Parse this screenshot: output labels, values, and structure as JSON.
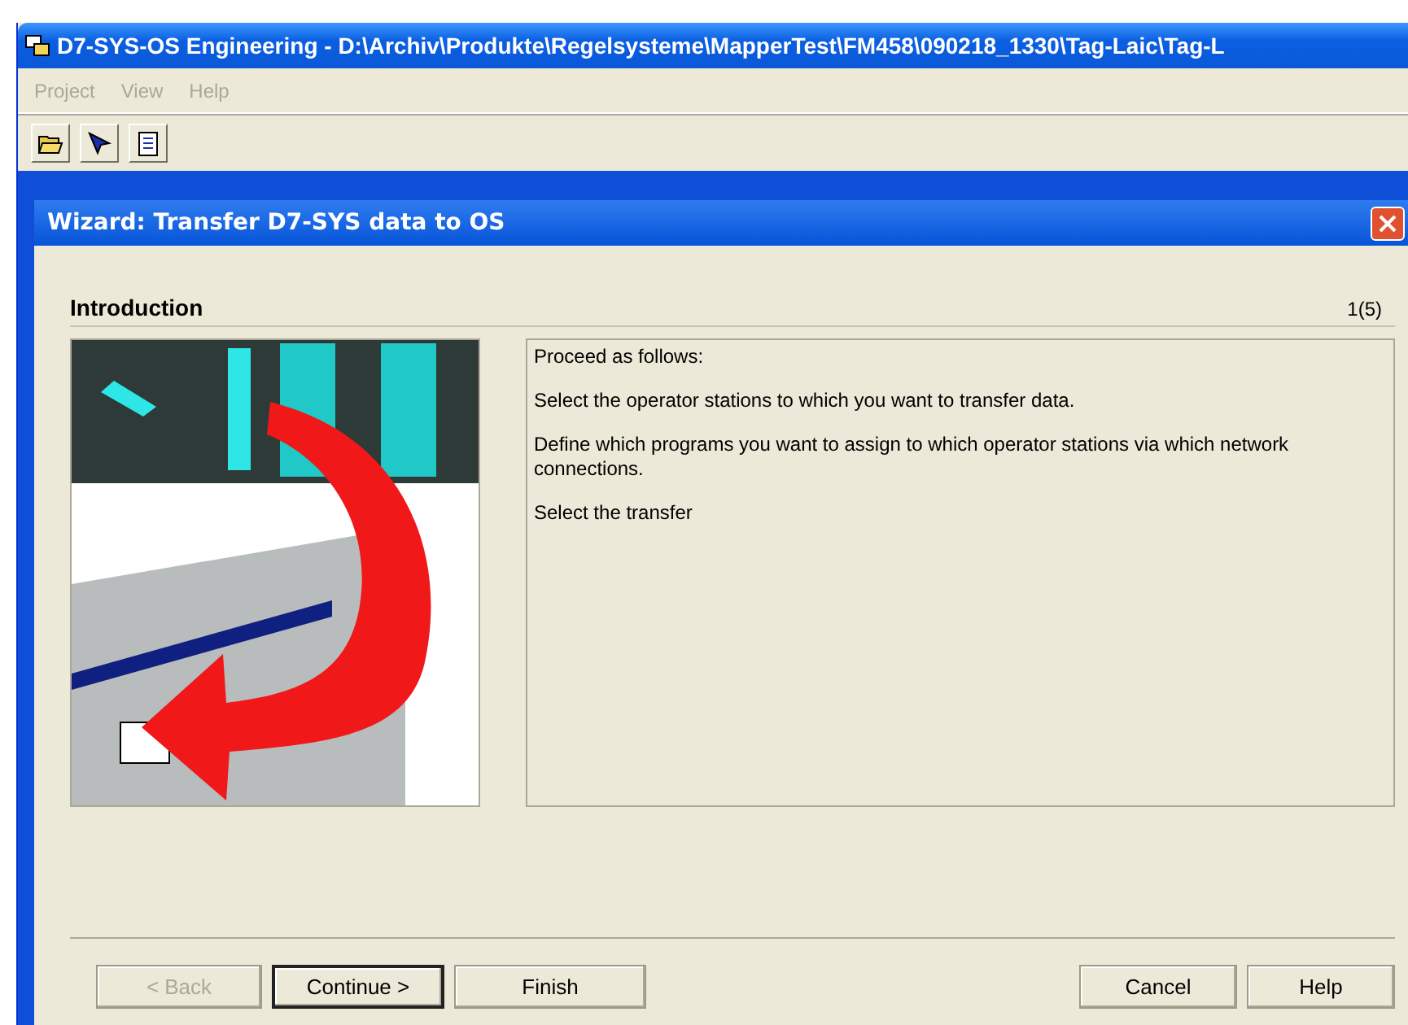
{
  "window": {
    "title": "D7-SYS-OS Engineering - D:\\Archiv\\Produkte\\Regelsysteme\\MapperTest\\FM458\\090218_1330\\Tag-Laic\\Tag-L"
  },
  "menu": [
    {
      "label": "Project",
      "disabled": true
    },
    {
      "label": "View",
      "disabled": true
    },
    {
      "label": "Help",
      "disabled": true
    }
  ],
  "toolbar": [
    {
      "kind": "open"
    },
    {
      "kind": "pointer"
    },
    {
      "kind": "document"
    }
  ],
  "dialog": {
    "title": "Wizard: Transfer D7-SYS data to OS",
    "heading": "Introduction",
    "step": "1(5)",
    "paragraphs": [
      "Proceed as follows:",
      "Select the operator stations to which you want to transfer data.",
      "Define which programs you want to assign to which operator stations via which network connections.",
      "Select the transfer"
    ],
    "left_buttons": [
      {
        "label": "< Back",
        "disabled": true,
        "default": false
      },
      {
        "label": "Continue >",
        "disabled": false,
        "default": true
      },
      {
        "label": "Finish",
        "disabled": false,
        "default": false
      }
    ],
    "right_buttons": [
      {
        "label": "Cancel",
        "disabled": false,
        "default": false
      },
      {
        "label": "Help",
        "disabled": false,
        "default": false
      }
    ]
  }
}
